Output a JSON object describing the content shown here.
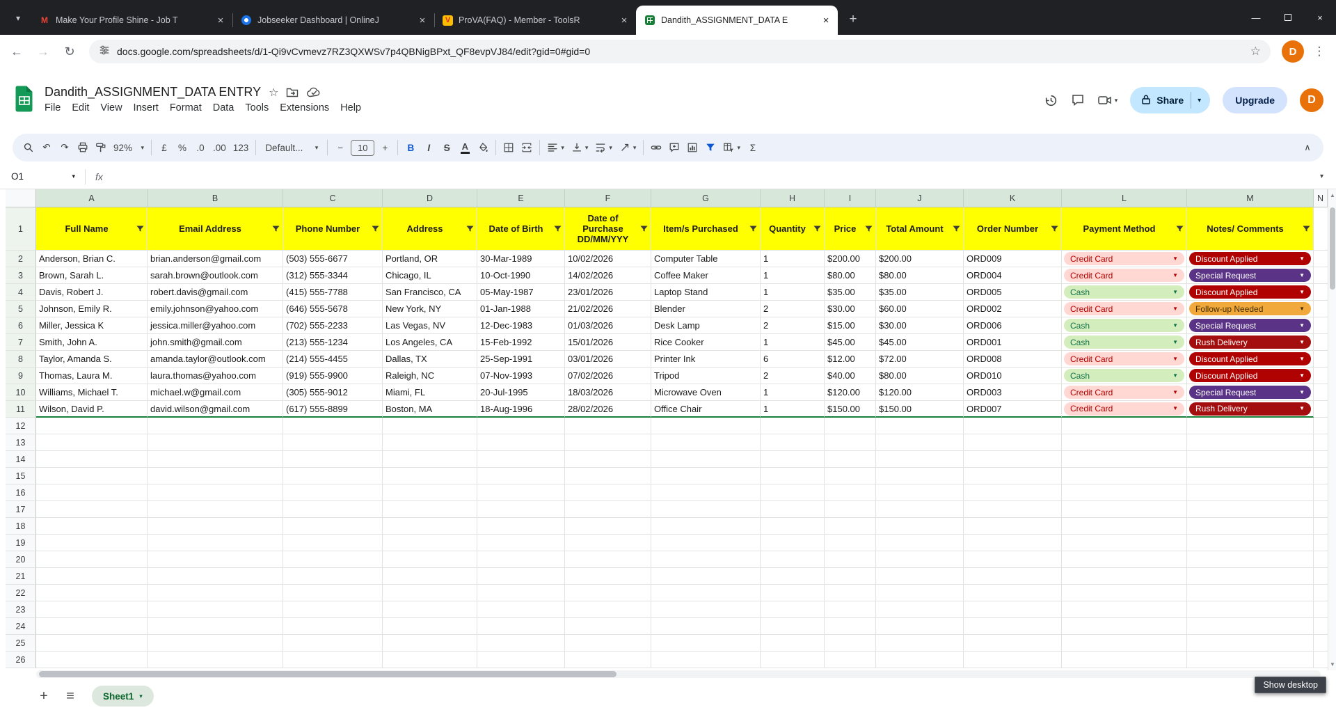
{
  "browser": {
    "tabs": [
      {
        "title": "Make Your Profile Shine - Job T",
        "favicon": "gmail",
        "active": false
      },
      {
        "title": "Jobseeker Dashboard | OnlineJ",
        "favicon": "jobseeker",
        "active": false
      },
      {
        "title": "ProVA(FAQ) - Member - ToolsR",
        "favicon": "prova",
        "active": false
      },
      {
        "title": "Dandith_ASSIGNMENT_DATA E",
        "favicon": "sheets",
        "active": true
      }
    ],
    "url": "docs.google.com/spreadsheets/d/1-Qi9vCvmevz7RZ3QXWSv7p4QBNigBPxt_QF8evpVJ84/edit?gid=0#gid=0",
    "profile_initial": "D"
  },
  "header": {
    "title": "Dandith_ASSIGNMENT_DATA ENTRY",
    "menus": [
      "File",
      "Edit",
      "View",
      "Insert",
      "Format",
      "Data",
      "Tools",
      "Extensions",
      "Help"
    ],
    "share_label": "Share",
    "upgrade_label": "Upgrade",
    "profile_initial": "D"
  },
  "toolbar": {
    "zoom": "92%",
    "currency": "£",
    "percent": "%",
    "decrease_decimal": ".0",
    "increase_decimal": ".00",
    "number_format": "123",
    "font_name": "Default...",
    "font_size": "10",
    "decrease_font": "−",
    "increase_font": "+",
    "bold": "B",
    "italic": "I",
    "strikethrough": "S",
    "text_color": "A",
    "functions": "Σ"
  },
  "formula_bar": {
    "name_box": "O1",
    "fx_label": "fx"
  },
  "sheet": {
    "column_letters": [
      "A",
      "B",
      "C",
      "D",
      "E",
      "F",
      "G",
      "H",
      "I",
      "J",
      "K",
      "L",
      "M",
      "N"
    ],
    "header_row": [
      "Full Name",
      "Email Address",
      "Phone Number",
      "Address",
      "Date of Birth",
      "Date of Purchase DD/MM/YYY",
      "Item/s Purchased",
      "Quantity",
      "Price",
      "Total Amount",
      "Order Number",
      "Payment Method",
      "Notes/ Comments"
    ],
    "rows": [
      [
        "Anderson, Brian C.",
        "brian.anderson@gmail.com",
        "(503) 555-6677",
        "Portland, OR",
        "30-Mar-1989",
        "10/02/2026",
        "Computer Table",
        "1",
        "$200.00",
        "$200.00",
        "ORD009",
        "Credit Card",
        "Discount Applied"
      ],
      [
        "Brown, Sarah L.",
        "sarah.brown@outlook.com",
        "(312) 555-3344",
        "Chicago, IL",
        "10-Oct-1990",
        "14/02/2026",
        "Coffee Maker",
        "1",
        "$80.00",
        "$80.00",
        "ORD004",
        "Credit Card",
        "Special Request"
      ],
      [
        "Davis, Robert J.",
        "robert.davis@gmail.com",
        "(415) 555-7788",
        "San Francisco, CA",
        "05-May-1987",
        "23/01/2026",
        "Laptop Stand",
        "1",
        "$35.00",
        "$35.00",
        "ORD005",
        "Cash",
        "Discount Applied"
      ],
      [
        "Johnson, Emily R.",
        "emily.johnson@yahoo.com",
        "(646) 555-5678",
        "New York, NY",
        "01-Jan-1988",
        "21/02/2026",
        "Blender",
        "2",
        "$30.00",
        "$60.00",
        "ORD002",
        "Credit Card",
        "Follow-up Needed"
      ],
      [
        "Miller, Jessica K",
        "jessica.miller@yahoo.com",
        "(702) 555-2233",
        "Las Vegas, NV",
        "12-Dec-1983",
        "01/03/2026",
        "Desk Lamp",
        "2",
        "$15.00",
        "$30.00",
        "ORD006",
        "Cash",
        "Special Request"
      ],
      [
        "Smith, John A.",
        "john.smith@gmail.com",
        "(213) 555-1234",
        "Los Angeles, CA",
        "15-Feb-1992",
        "15/01/2026",
        "Rice Cooker",
        "1",
        "$45.00",
        "$45.00",
        "ORD001",
        "Cash",
        "Rush Delivery"
      ],
      [
        "Taylor, Amanda S.",
        "amanda.taylor@outlook.com",
        "(214) 555-4455",
        "Dallas, TX",
        "25-Sep-1991",
        "03/01/2026",
        "Printer Ink",
        "6",
        "$12.00",
        "$72.00",
        "ORD008",
        "Credit Card",
        "Discount Applied"
      ],
      [
        "Thomas, Laura M.",
        "laura.thomas@yahoo.com",
        "(919) 555-9900",
        "Raleigh, NC",
        "07-Nov-1993",
        "07/02/2026",
        "Tripod",
        "2",
        "$40.00",
        "$80.00",
        "ORD010",
        "Cash",
        "Discount Applied"
      ],
      [
        "Williams, Michael T.",
        "michael.w@gmail.com",
        "(305) 555-9012",
        "Miami, FL",
        "20-Jul-1995",
        "18/03/2026",
        "Microwave Oven",
        "1",
        "$120.00",
        "$120.00",
        "ORD003",
        "Credit Card",
        "Special Request"
      ],
      [
        "Wilson, David P.",
        "david.wilson@gmail.com",
        "(617) 555-8899",
        "Boston, MA",
        "18-Aug-1996",
        "28/02/2026",
        "Office Chair",
        "1",
        "$150.00",
        "$150.00",
        "ORD007",
        "Credit Card",
        "Rush Delivery"
      ]
    ],
    "first_data_row": 2,
    "last_visible_row": 26,
    "filter_range_end_row": 11
  },
  "chips": {
    "Credit Card": {
      "bg": "#ffd7d3",
      "fg": "#b10202"
    },
    "Cash": {
      "bg": "#d4edbc",
      "fg": "#11734b"
    },
    "Discount Applied": {
      "bg": "#b10202",
      "fg": "#ffffff"
    },
    "Special Request": {
      "bg": "#5a3286",
      "fg": "#ffffff"
    },
    "Follow-up Needed": {
      "bg": "#f2a93b",
      "fg": "#402c00"
    },
    "Rush Delivery": {
      "bg": "#a50e0e",
      "fg": "#ffffff"
    }
  },
  "bottom_bar": {
    "active_sheet": "Sheet1"
  },
  "tooltip": "Show desktop",
  "colors": {
    "accent_blue": "#0b57d0",
    "filter_green": "#188038",
    "header_yellow": "#ffff00",
    "share_pill": "#c2e7ff",
    "avatar_orange": "#e8710a"
  }
}
